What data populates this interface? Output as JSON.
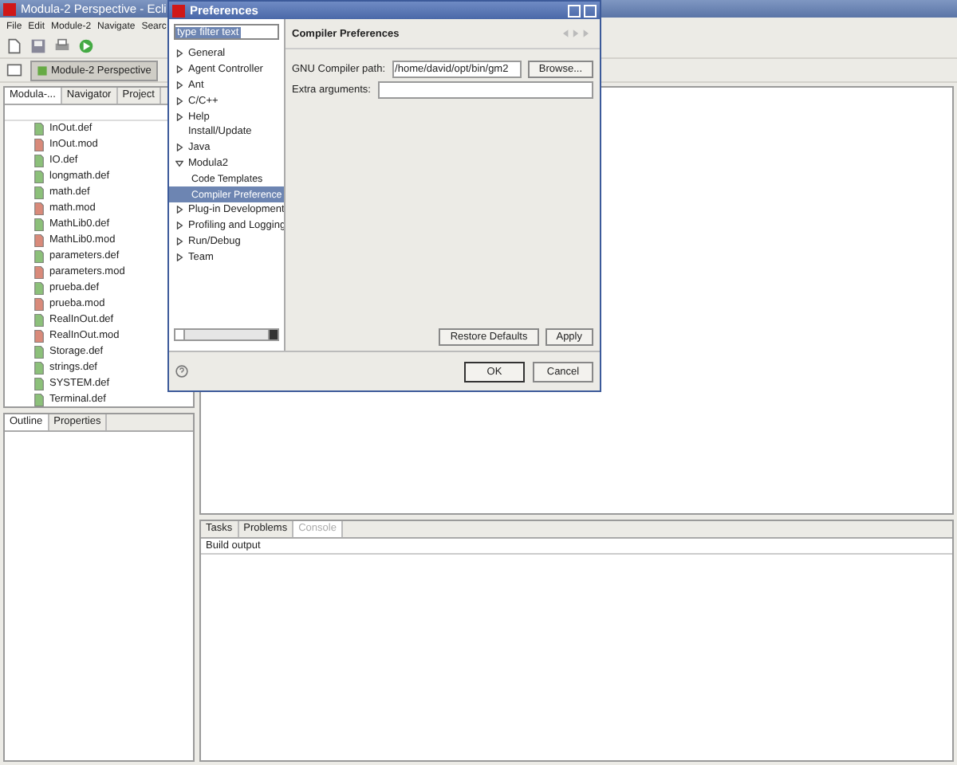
{
  "window": {
    "title": "Modula-2 Perspective - Ecli"
  },
  "menu": [
    "File",
    "Edit",
    "Module-2",
    "Navigate",
    "Searc"
  ],
  "perspective": {
    "label": "Module-2 Perspective"
  },
  "explorer": {
    "tabs": [
      {
        "label": "Modula-...",
        "selected": true
      },
      {
        "label": "Navigator",
        "selected": false
      },
      {
        "label": "Project",
        "selected": false
      }
    ],
    "files": [
      {
        "name": "InOut.def",
        "kind": "def"
      },
      {
        "name": "InOut.mod",
        "kind": "mod"
      },
      {
        "name": "IO.def",
        "kind": "def"
      },
      {
        "name": "longmath.def",
        "kind": "def"
      },
      {
        "name": "math.def",
        "kind": "def"
      },
      {
        "name": "math.mod",
        "kind": "mod"
      },
      {
        "name": "MathLib0.def",
        "kind": "def"
      },
      {
        "name": "MathLib0.mod",
        "kind": "mod"
      },
      {
        "name": "parameters.def",
        "kind": "def"
      },
      {
        "name": "parameters.mod",
        "kind": "mod"
      },
      {
        "name": "prueba.def",
        "kind": "def"
      },
      {
        "name": "prueba.mod",
        "kind": "mod"
      },
      {
        "name": "RealInOut.def",
        "kind": "def"
      },
      {
        "name": "RealInOut.mod",
        "kind": "mod"
      },
      {
        "name": "Storage.def",
        "kind": "def"
      },
      {
        "name": "strings.def",
        "kind": "def"
      },
      {
        "name": "SYSTEM.def",
        "kind": "def"
      },
      {
        "name": "Terminal.def",
        "kind": "def"
      }
    ]
  },
  "outline": {
    "tabs": [
      {
        "label": "Outline",
        "selected": true
      },
      {
        "label": "Properties",
        "selected": false
      }
    ]
  },
  "bottom": {
    "tabs": [
      {
        "label": "Tasks",
        "selected": false
      },
      {
        "label": "Problems",
        "selected": false
      },
      {
        "label": "Console",
        "selected": true
      }
    ],
    "console_title": "Build output"
  },
  "dialog": {
    "title": "Preferences",
    "filter": "type filter text",
    "tree": [
      {
        "label": "General",
        "kind": "group",
        "expanded": false
      },
      {
        "label": "Agent Controller",
        "kind": "group",
        "expanded": false
      },
      {
        "label": "Ant",
        "kind": "group",
        "expanded": false
      },
      {
        "label": "C/C++",
        "kind": "group",
        "expanded": false
      },
      {
        "label": "Help",
        "kind": "group",
        "expanded": false
      },
      {
        "label": "Install/Update",
        "kind": "page",
        "selected": false
      },
      {
        "label": "Java",
        "kind": "group",
        "expanded": false
      },
      {
        "label": "Modula2",
        "kind": "group",
        "expanded": true,
        "children": [
          {
            "label": "Code Templates",
            "kind": "page",
            "selected": false
          },
          {
            "label": "Compiler Preference",
            "kind": "page",
            "selected": true
          }
        ]
      },
      {
        "label": "Plug-in Development",
        "kind": "group",
        "expanded": false
      },
      {
        "label": "Profiling and Logging",
        "kind": "group",
        "expanded": false
      },
      {
        "label": "Run/Debug",
        "kind": "group",
        "expanded": false
      },
      {
        "label": "Team",
        "kind": "group",
        "expanded": false
      }
    ],
    "page_title": "Compiler Preferences",
    "fields": [
      {
        "label": "GNU Compiler path:",
        "value": "/home/david/opt/bin/gm2",
        "button": "Browse..."
      },
      {
        "label": "Extra arguments:"
      }
    ],
    "buttons": {
      "restore": "Restore Defaults",
      "apply": "Apply",
      "ok": "OK",
      "cancel": "Cancel"
    }
  }
}
